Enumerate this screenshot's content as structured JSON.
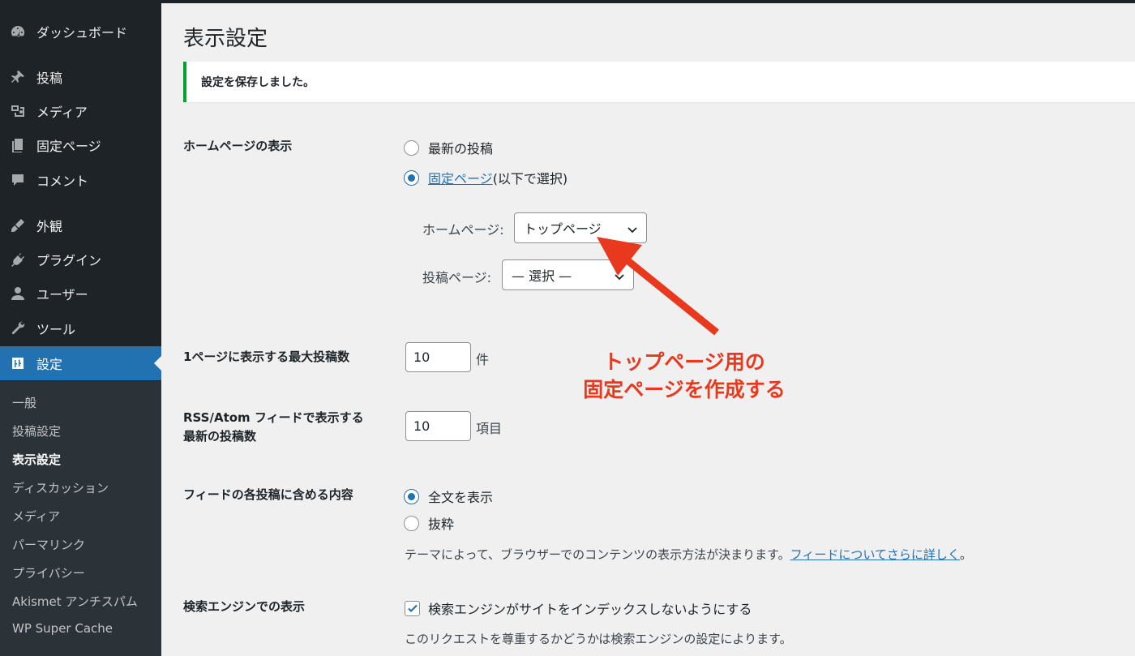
{
  "sidebar": {
    "items": [
      {
        "label": "ダッシュボード",
        "icon": "dashboard-icon"
      },
      {
        "label": "投稿",
        "icon": "pin-icon"
      },
      {
        "label": "メディア",
        "icon": "media-icon"
      },
      {
        "label": "固定ページ",
        "icon": "pages-icon"
      },
      {
        "label": "コメント",
        "icon": "comment-icon"
      },
      {
        "label": "外観",
        "icon": "appearance-icon"
      },
      {
        "label": "プラグイン",
        "icon": "plugin-icon"
      },
      {
        "label": "ユーザー",
        "icon": "user-icon"
      },
      {
        "label": "ツール",
        "icon": "wrench-icon"
      },
      {
        "label": "設定",
        "icon": "settings-icon",
        "active": true
      }
    ],
    "submenu": [
      {
        "label": "一般"
      },
      {
        "label": "投稿設定"
      },
      {
        "label": "表示設定",
        "current": true
      },
      {
        "label": "ディスカッション"
      },
      {
        "label": "メディア"
      },
      {
        "label": "パーマリンク"
      },
      {
        "label": "プライバシー"
      },
      {
        "label": "Akismet アンチスパム"
      },
      {
        "label": "WP Super Cache"
      }
    ]
  },
  "page": {
    "title": "表示設定",
    "notice": "設定を保存しました。"
  },
  "homepage": {
    "label": "ホームページの表示",
    "opt_latest": "最新の投稿",
    "opt_static_link": "固定ページ",
    "opt_static_suffix": " (以下で選択)",
    "selected": "static",
    "front_label": "ホームページ:",
    "front_value": "トップページ",
    "posts_label": "投稿ページ:",
    "posts_value": "— 選択 —"
  },
  "posts_per_page": {
    "label": "1ページに表示する最大投稿数",
    "value": "10",
    "unit": "件"
  },
  "rss_posts": {
    "label_line1": "RSS/Atom フィードで表示する",
    "label_line2": "最新の投稿数",
    "value": "10",
    "unit": "項目"
  },
  "feed_content": {
    "label": "フィードの各投稿に含める内容",
    "opt_full": "全文を表示",
    "opt_excerpt": "抜粋",
    "selected": "full",
    "desc_prefix": "テーマによって、ブラウザーでのコンテンツの表示方法が決まります。",
    "desc_link": "フィードについてさらに詳しく",
    "desc_suffix": "。"
  },
  "search_engine": {
    "label": "検索エンジンでの表示",
    "checkbox_label": "検索エンジンがサイトをインデックスしないようにする",
    "checked": true,
    "desc": "このリクエストを尊重するかどうかは検索エンジンの設定によります。"
  },
  "annotation": {
    "line1": "トップページ用の",
    "line2": "固定ページを作成する",
    "color": "#e8391f"
  },
  "colors": {
    "sidebar_bg": "#1d2327",
    "submenu_bg": "#2c3338",
    "accent": "#2271b1",
    "notice_border": "#00a32a"
  }
}
